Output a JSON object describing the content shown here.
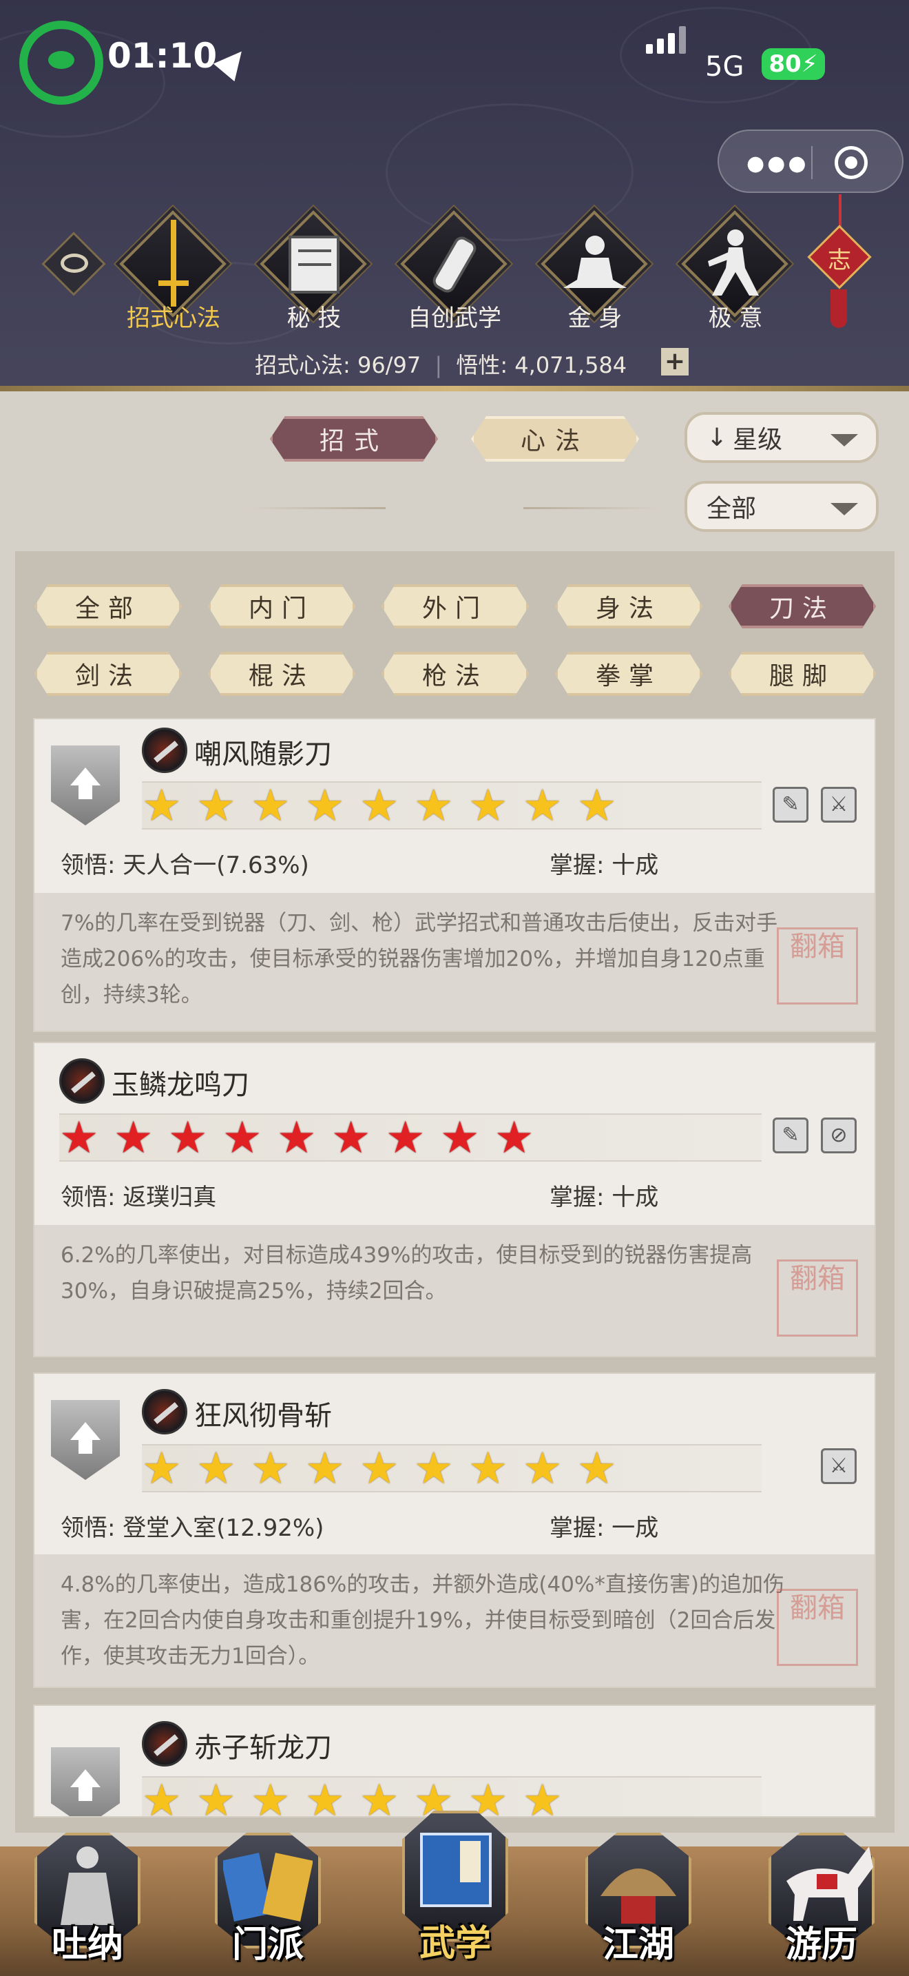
{
  "status_bar": {
    "time": "01:10",
    "network": "5G",
    "battery": "80"
  },
  "header": {
    "tabs": [
      {
        "label": "招式心法",
        "icon": "sword-icon",
        "active": true
      },
      {
        "label": "秘 技",
        "icon": "book-icon"
      },
      {
        "label": "自创武学",
        "icon": "scroll-icon"
      },
      {
        "label": "金 身",
        "icon": "meditation-icon"
      },
      {
        "label": "极 意",
        "icon": "martial-pose-icon"
      }
    ],
    "ornament": "志",
    "stats": {
      "moves_label": "招式心法:",
      "moves_value": "96/97",
      "insight_label": "悟性:",
      "insight_value": "4,071,584",
      "add": "+"
    }
  },
  "filters": {
    "type_tabs": [
      {
        "label": "招式",
        "active": true
      },
      {
        "label": "心法",
        "active": false
      }
    ],
    "sort": "星级",
    "scope": "全部",
    "categories": [
      {
        "label": "全部"
      },
      {
        "label": "内门"
      },
      {
        "label": "外门"
      },
      {
        "label": "身法"
      },
      {
        "label": "刀法",
        "active": true
      },
      {
        "label": "剑法"
      },
      {
        "label": "棍法"
      },
      {
        "label": "枪法"
      },
      {
        "label": "拳掌"
      },
      {
        "label": "腿脚"
      }
    ]
  },
  "cards": [
    {
      "name": "嘲风随影刀",
      "stars": 9,
      "star_color": "gold",
      "upgradable": true,
      "comprehension_label": "领悟:",
      "comprehension": "天人合一(7.63%)",
      "mastery_label": "掌握:",
      "mastery": "十成",
      "desc": "7%的几率在受到锐器（刀、剑、枪）武学招式和普通攻击后使出，反击对手造成206%的攻击，使目标承受的锐器伤害增加20%，并增加自身120点重创，持续3轮。",
      "seal": "翻箱"
    },
    {
      "name": "玉鳞龙鸣刀",
      "stars": 9,
      "star_color": "red",
      "upgradable": false,
      "comprehension_label": "领悟:",
      "comprehension": "返璞归真",
      "mastery_label": "掌握:",
      "mastery": "十成",
      "desc": "6.2%的几率使出，对目标造成439%的攻击，使目标受到的锐器伤害提高30%，自身识破提高25%，持续2回合。",
      "seal": "翻箱"
    },
    {
      "name": "狂风彻骨斩",
      "stars": 9,
      "star_color": "gold",
      "upgradable": true,
      "comprehension_label": "领悟:",
      "comprehension": "登堂入室(12.92%)",
      "mastery_label": "掌握:",
      "mastery": "一成",
      "desc": "4.8%的几率使出，造成186%的攻击，并额外造成(40%*直接伤害)的追加伤害，在2回合内使自身攻击和重创提升19%，并使目标受到暗创（2回合后发作，使其攻击无力1回合）。",
      "seal": "翻箱"
    },
    {
      "name": "赤子斩龙刀",
      "stars": 8,
      "star_color": "gold",
      "upgradable": true
    }
  ],
  "bottom_nav": [
    {
      "label": "吐纳"
    },
    {
      "label": "门派"
    },
    {
      "label": "武学",
      "active": true
    },
    {
      "label": "江湖"
    },
    {
      "label": "游历"
    }
  ],
  "colors": {
    "accent_dark": "#7a5158",
    "star_gold": "#f7c21c",
    "star_red": "#e02022",
    "header_bg": "#3f3e55"
  }
}
